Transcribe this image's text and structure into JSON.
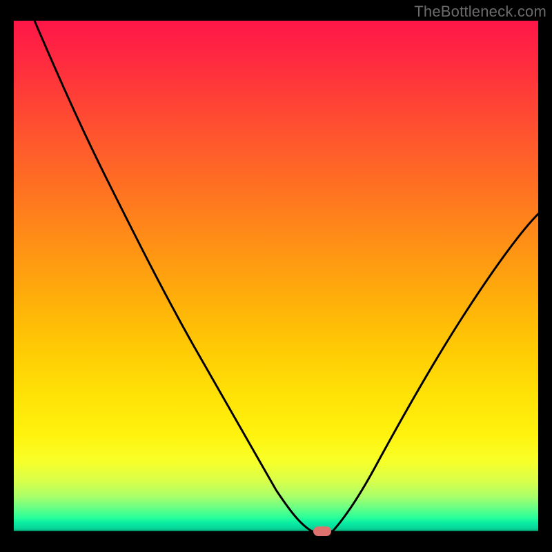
{
  "watermark": "TheBottleneck.com",
  "chart_data": {
    "type": "line",
    "title": "",
    "xlabel": "",
    "ylabel": "",
    "xlim": [
      0,
      100
    ],
    "ylim": [
      0,
      100
    ],
    "background_gradient": {
      "top_color": "#ff1648",
      "mid_color": "#ffcc04",
      "bottom_color": "#07d89a",
      "orientation": "vertical"
    },
    "series": [
      {
        "name": "bottleneck-curve",
        "x": [
          4,
          10,
          18,
          26,
          34,
          42,
          48,
          52,
          55,
          57,
          58,
          60,
          64,
          70,
          78,
          86,
          94,
          100
        ],
        "values": [
          100,
          90,
          78,
          66,
          53,
          38,
          24,
          12,
          4,
          1,
          0,
          0,
          6,
          16,
          30,
          43,
          54,
          62
        ]
      }
    ],
    "marker": {
      "x": 58.5,
      "y": 0,
      "color": "#e0726d"
    }
  }
}
